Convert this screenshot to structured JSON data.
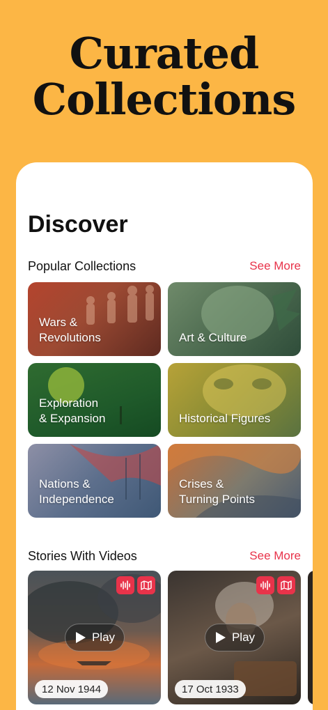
{
  "hero": {
    "line1": "Curated",
    "line2": "Collections"
  },
  "discover": {
    "title": "Discover"
  },
  "popular": {
    "title": "Popular Collections",
    "see_more": "See More",
    "collections": [
      {
        "label": "Wars &\nRevolutions"
      },
      {
        "label": "Art & Culture"
      },
      {
        "label": "Exploration\n& Expansion"
      },
      {
        "label": "Historical Figures"
      },
      {
        "label": "Nations &\nIndependence"
      },
      {
        "label": "Crises &\nTurning Points"
      }
    ]
  },
  "stories": {
    "title": "Stories With Videos",
    "see_more": "See More",
    "play_label": "Play",
    "cards": [
      {
        "date": "12 Nov 1944"
      },
      {
        "date": "17 Oct 1933"
      }
    ]
  },
  "colors": {
    "background": "#FCB645",
    "accent": "#E8334A",
    "card": "#FFFFFF"
  },
  "icons": {
    "audio": "audio-waveform-icon",
    "map": "map-icon",
    "play": "play-icon"
  }
}
